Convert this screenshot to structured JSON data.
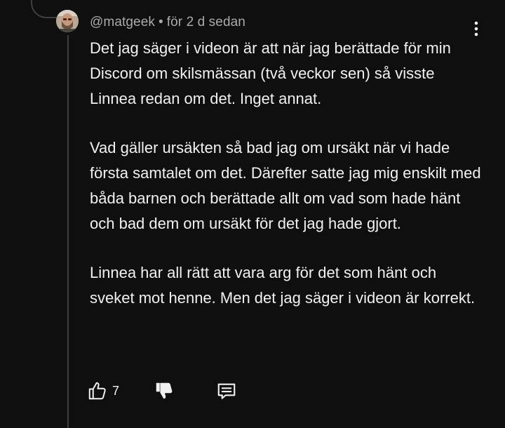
{
  "comment": {
    "author": "@matgeek",
    "separator": "•",
    "time": "för 2 d sedan",
    "paragraphs": [
      "Det jag säger i videon är att när jag berättade för min Discord om skilsmässan (två veckor sen) så visste Linnea redan om det. Inget annat.",
      "Vad gäller ursäkten så bad jag om ursäkt när vi hade första samtalet om det. Därefter satte jag mig enskilt med båda barnen och berättade allt om vad som hade hänt och bad dem om ursäkt för det jag hade gjort.",
      "Linnea har all rätt att vara arg för det som hänt och sveket mot henne. Men det jag säger i videon är korrekt."
    ],
    "likes": "7"
  },
  "icons": {
    "more": "more-vertical-icon",
    "like": "thumbs-up-icon",
    "dislike": "thumbs-down-icon",
    "reply": "reply-comment-icon"
  },
  "colors": {
    "background": "#0f0f0f",
    "text": "#f1f1f1",
    "meta": "#aaaaaa",
    "thread_line": "#3f3f3f"
  }
}
